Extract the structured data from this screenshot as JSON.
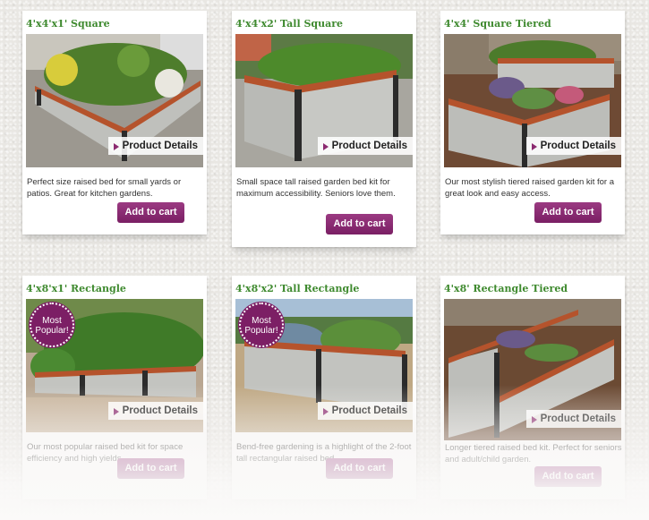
{
  "products": [
    {
      "title": "4'x4'x1' Square",
      "details_label": "Product Details",
      "description": "Perfect size raised bed for small yards or patios.  Great for kitchen gardens.",
      "cart_label": "Add to cart",
      "badge": ""
    },
    {
      "title": "4'x4'x2' Tall Square",
      "details_label": "Product Details",
      "description": "Small space tall raised garden bed kit for maximum accessibility. Seniors love them.",
      "cart_label": "Add to cart",
      "badge": ""
    },
    {
      "title": "4'x4' Square Tiered",
      "details_label": "Product Details",
      "description": "Our most stylish tiered raised garden kit for a great look and easy access.",
      "cart_label": "Add to cart",
      "badge": ""
    },
    {
      "title": "4'x8'x1' Rectangle",
      "details_label": "Product Details",
      "description": "Our most popular raised bed kit for space efficiency and high yields.",
      "cart_label": "Add to cart",
      "badge": "Most Popular!"
    },
    {
      "title": "4'x8'x2' Tall Rectangle",
      "details_label": "Product Details",
      "description": "Bend-free gardening is a highlight of the 2-foot tall rectangular raised bed.",
      "cart_label": "Add to cart",
      "badge": "Most Popular!"
    },
    {
      "title": "4'x8' Rectangle Tiered",
      "details_label": "Product Details",
      "description": "Longer tiered raised bed kit.  Perfect for seniors and adult/child garden.",
      "cart_label": "Add to cart",
      "badge": ""
    }
  ],
  "colors": {
    "title_green": "#3f8a2f",
    "button_purple": "#8b2a70",
    "bed_wood": "#b5532c",
    "bed_panel": "#b8b9b6"
  }
}
